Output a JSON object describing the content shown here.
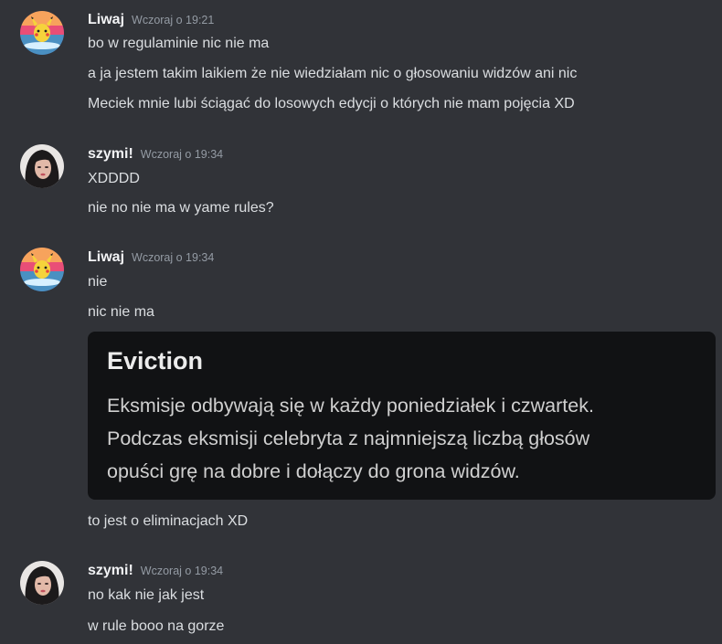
{
  "messages": [
    {
      "author": "Liwaj",
      "avatar_icon": "pikachu-surfboard-avatar",
      "timestamp": "Wczoraj o 19:21",
      "lines": [
        "bo w regulaminie nic nie ma",
        "a ja jestem takim laikiem że nie wiedziałam nic o głosowaniu widzów ani nic",
        "Meciek mnie lubi ściągać do losowych edycji o których nie mam pojęcia XD"
      ]
    },
    {
      "author": "szymi!",
      "avatar_icon": "dark-haired-person-avatar",
      "timestamp": "Wczoraj o 19:34",
      "lines": [
        "XDDDD",
        "nie no nie ma w yame rules?"
      ]
    },
    {
      "author": "Liwaj",
      "avatar_icon": "pikachu-surfboard-avatar",
      "timestamp": "Wczoraj o 19:34",
      "lines": [
        "nie",
        "nic nie ma"
      ],
      "embed": {
        "title": "Eviction",
        "lines": [
          "Eksmisje odbywają się w każdy poniedziałek i czwartek.",
          "Podczas eksmisji celebryta z najmniejszą liczbą głosów",
          "opuści grę na dobre i dołączy do grona widzów."
        ]
      },
      "after_embed": "to jest o eliminacjach XD"
    },
    {
      "author": "szymi!",
      "avatar_icon": "dark-haired-person-avatar",
      "timestamp": "Wczoraj o 19:34",
      "lines": [
        "no kak nie jak jest",
        "w rule booo na gorze"
      ]
    }
  ],
  "colors": {
    "background": "#313338",
    "embed_background": "#111214",
    "username": "#f2f3f5",
    "message_text": "#dbdee1",
    "timestamp": "#949ba4"
  }
}
